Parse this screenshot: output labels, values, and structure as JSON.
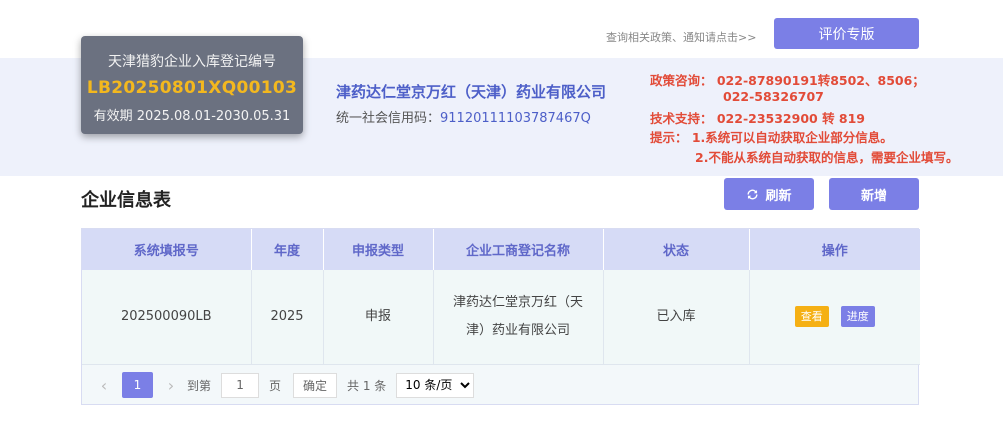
{
  "top": {
    "policy_link": "查询相关政策、通知请点击>>",
    "eval_button": "评价专版"
  },
  "registration": {
    "title": "天津猎豹企业入库登记编号",
    "code": "LB20250801XQ00103",
    "valid": "有效期 2025.08.01-2030.05.31"
  },
  "company": {
    "name": "津药达仁堂京万红（天津）药业有限公司",
    "credit_label": "统一社会信用码：",
    "credit_code": "91120111103787467Q"
  },
  "contact": {
    "policy_line1": "政策咨询： 022-87890191转8502、8506；",
    "policy_line2": "022-58326707",
    "tech_line": "技术支持： 022-23532900 转 819",
    "tip_line1": "提示： 1.系统可以自动获取企业部分信息。",
    "tip_line2": "2.不能从系统自动获取的信息，需要企业填写。"
  },
  "section": {
    "title": "企业信息表",
    "refresh_label": "刷新",
    "refresh_icon": "refresh-icon",
    "add_label": "新增"
  },
  "table": {
    "headers": [
      "系统填报号",
      "年度",
      "申报类型",
      "企业工商登记名称",
      "状态",
      "操作"
    ],
    "rows": [
      {
        "number": "202500090LB",
        "year": "2025",
        "type": "申报",
        "name": "津药达仁堂京万红（天津）药业有限公司",
        "status": "已入库",
        "view": "查看",
        "progress": "进度"
      }
    ]
  },
  "pager": {
    "prev_icon": "chevron-left-icon",
    "next_icon": "chevron-right-icon",
    "current": "1",
    "goto_label": "到第",
    "goto_value": "1",
    "page_label": "页",
    "confirm": "确定",
    "total": "共 1 条",
    "page_size": "10 条/页"
  },
  "colors": {
    "accent": "#7b7fe6",
    "warning": "#f5b014",
    "alert_text": "#e24b38",
    "code_gold": "#f3b81e"
  }
}
